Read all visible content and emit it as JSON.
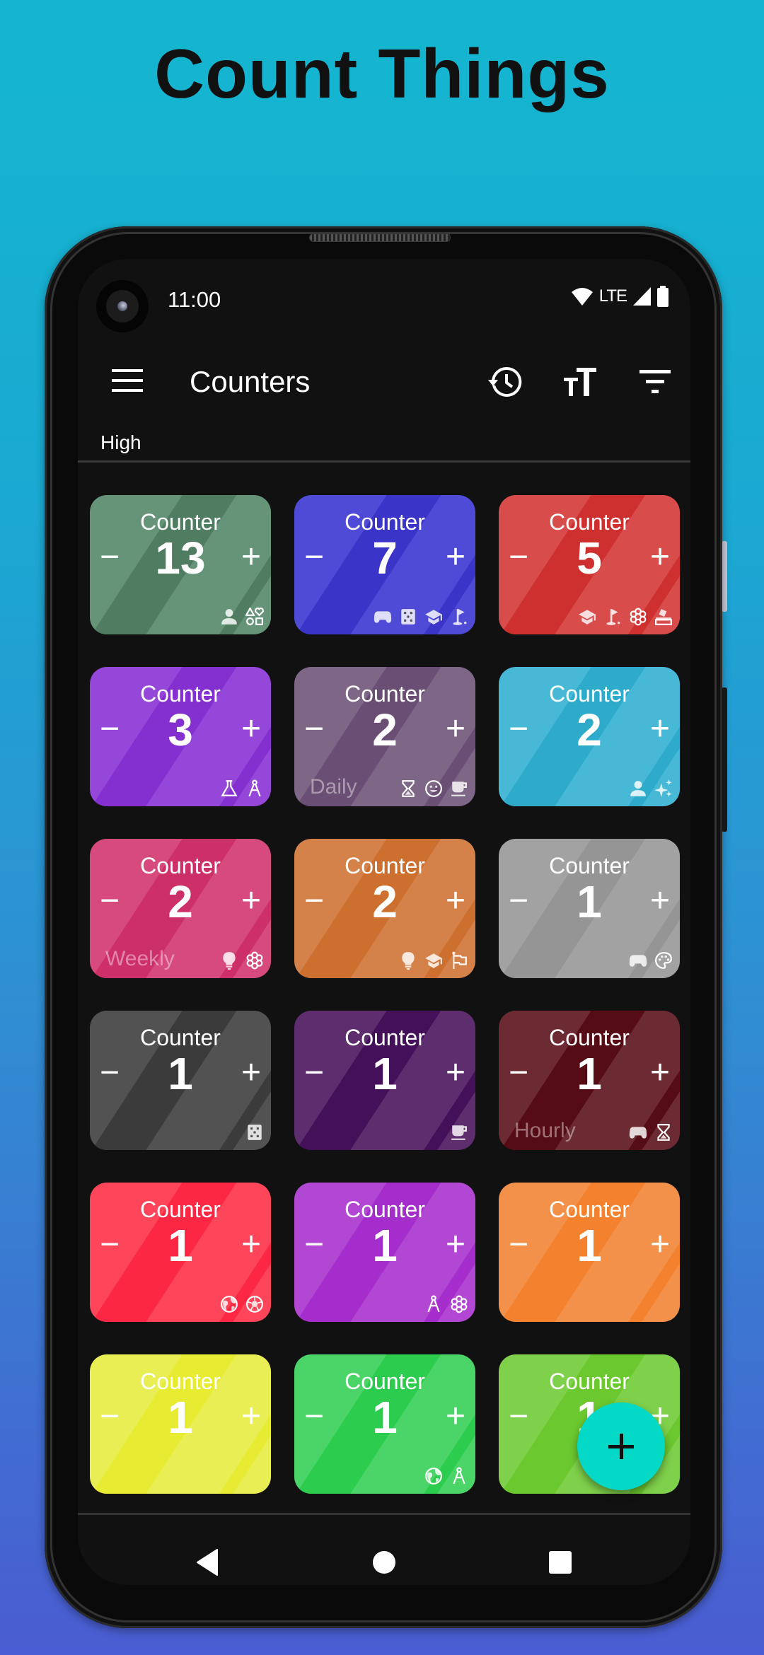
{
  "promo": {
    "title": "Count Things"
  },
  "status_bar": {
    "time": "11:00",
    "network": "LTE",
    "icons": [
      "wifi-icon",
      "signal-icon",
      "battery-icon"
    ]
  },
  "app_bar": {
    "title": "Counters",
    "menu_icon": "hamburger-menu-icon",
    "actions": [
      {
        "name": "history-icon",
        "label": "History"
      },
      {
        "name": "text-size-icon",
        "label": "Text size"
      },
      {
        "name": "filter-icon",
        "label": "Sort / filter"
      }
    ]
  },
  "section": {
    "label": "High"
  },
  "colors": {
    "screen_bg": "#111111",
    "fab": "#04d8c7",
    "background_top": "#14b6cf",
    "background_bottom": "#4a5cd1"
  },
  "counters": [
    {
      "label": "Counter",
      "value": "13",
      "frequency": "",
      "color": "#669479",
      "dark": "#507c62",
      "icons": [
        "person-icon",
        "shapes-icon"
      ]
    },
    {
      "label": "Counter",
      "value": "7",
      "frequency": "",
      "color": "#4f4bd6",
      "dark": "#3a34c9",
      "icons": [
        "gamepad-icon",
        "dice-icon",
        "school-icon",
        "golf-icon"
      ]
    },
    {
      "label": "Counter",
      "value": "5",
      "frequency": "",
      "color": "#d84c4c",
      "dark": "#cd302f",
      "icons": [
        "school-icon",
        "golf-icon",
        "flower-icon",
        "ballot-icon"
      ]
    },
    {
      "label": "Counter",
      "value": "3",
      "frequency": "",
      "color": "#9447d8",
      "dark": "#842fd0",
      "icons": [
        "flask-icon",
        "compass-icon"
      ]
    },
    {
      "label": "Counter",
      "value": "2",
      "frequency": "Daily",
      "color": "#7e6686",
      "dark": "#6b4e74",
      "icons": [
        "hourglass-icon",
        "smile-icon",
        "coffee-icon"
      ]
    },
    {
      "label": "Counter",
      "value": "2",
      "frequency": "",
      "color": "#47b9d6",
      "dark": "#2eabcb",
      "icons": [
        "person-icon",
        "sparkle-icon"
      ]
    },
    {
      "label": "Counter",
      "value": "2",
      "frequency": "Weekly",
      "color": "#d64a7e",
      "dark": "#cd2f69",
      "icons": [
        "lightbulb-icon",
        "flower-icon"
      ]
    },
    {
      "label": "Counter",
      "value": "2",
      "frequency": "",
      "color": "#d5824a",
      "dark": "#cd6f2f",
      "icons": [
        "lightbulb-icon",
        "school-icon",
        "flag-icon"
      ]
    },
    {
      "label": "Counter",
      "value": "1",
      "frequency": "",
      "color": "#a2a2a2",
      "dark": "#959595",
      "icons": [
        "gamepad-icon",
        "palette-icon"
      ]
    },
    {
      "label": "Counter",
      "value": "1",
      "frequency": "",
      "color": "#525252",
      "dark": "#3b3b3b",
      "icons": [
        "dice-icon"
      ]
    },
    {
      "label": "Counter",
      "value": "1",
      "frequency": "",
      "color": "#5d2d6e",
      "dark": "#44105a",
      "icons": [
        "coffee-icon"
      ]
    },
    {
      "label": "Counter",
      "value": "1",
      "frequency": "Hourly",
      "color": "#6c2a33",
      "dark": "#560c15",
      "icons": [
        "gamepad-icon",
        "hourglass-icon"
      ]
    },
    {
      "label": "Counter",
      "value": "1",
      "frequency": "",
      "color": "#fe4559",
      "dark": "#fc2742",
      "icons": [
        "globe-icon",
        "soccer-icon"
      ]
    },
    {
      "label": "Counter",
      "value": "1",
      "frequency": "",
      "color": "#b247d4",
      "dark": "#a52dcb",
      "icons": [
        "compass-icon",
        "flower-icon"
      ]
    },
    {
      "label": "Counter",
      "value": "1",
      "frequency": "",
      "color": "#f3914a",
      "dark": "#f3812e",
      "icons": []
    },
    {
      "label": "Counter",
      "value": "1",
      "frequency": "",
      "color": "#e9ee54",
      "dark": "#e7ec33",
      "icons": []
    },
    {
      "label": "Counter",
      "value": "1",
      "frequency": "",
      "color": "#4bd569",
      "dark": "#2ccd4e",
      "icons": [
        "globe-icon",
        "compass-icon"
      ]
    },
    {
      "label": "Counter",
      "value": "1",
      "frequency": "",
      "color": "#7fd14b",
      "dark": "#6bc92f",
      "icons": []
    }
  ],
  "fab": {
    "label": "+",
    "name": "add-counter-button"
  },
  "nav_bar": {
    "buttons": [
      "back-icon",
      "home-icon",
      "recents-icon"
    ]
  }
}
